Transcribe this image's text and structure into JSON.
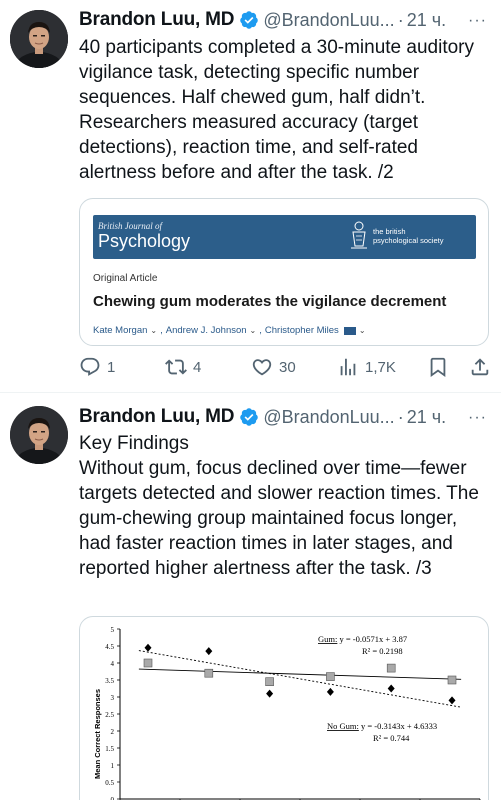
{
  "tweets": [
    {
      "author": {
        "name": "Brandon Luu, MD",
        "handle": "@BrandonLuu...",
        "dot": "·",
        "time": "21 ч."
      },
      "more": "···",
      "text": "40 participants completed a 30-minute auditory vigilance task, detecting specific number sequences. Half chewed gum, half didn’t. Researchers measured accuracy (target detections), reaction time, and self-rated alertness before and after the task. /2",
      "card": {
        "journal_small": "British Journal of",
        "journal_big": "Psychology",
        "society": "the british\npsychological society",
        "article_type": "Original Article",
        "title": "Chewing gum moderates the vigilance decrement",
        "authors": [
          "Kate Morgan",
          "Andrew J. Johnson",
          "Christopher Miles"
        ]
      },
      "actions": {
        "replies": "1",
        "retweets": "4",
        "likes": "30",
        "views": "1,7K"
      }
    },
    {
      "author": {
        "name": "Brandon Luu, MD",
        "handle": "@BrandonLuu...",
        "dot": "·",
        "time": "21 ч."
      },
      "more": "···",
      "text": "Key Findings\nWithout gum, focus declined over time—fewer targets detected and slower reaction times. The gum-chewing group maintained focus longer, had faster reaction times in later stages, and reported higher alertness after the task. /3"
    }
  ],
  "chart_data": {
    "type": "scatter",
    "ylabel": "Mean Correct Responses",
    "ylim": [
      0,
      5
    ],
    "yticks": [
      "0",
      "0.5",
      "1",
      "1.5",
      "2",
      "2.5",
      "3",
      "3.5",
      "4",
      "4.5",
      "5"
    ],
    "x": [
      1,
      2,
      3,
      4,
      5,
      6
    ],
    "series": [
      {
        "name": "Gum",
        "marker": "square",
        "values": [
          4.0,
          3.7,
          3.45,
          3.6,
          3.85,
          3.5
        ],
        "fit_label": "Gum:",
        "equation": "y = -0.0571x + 3.87",
        "r2": "R² = 0.2198",
        "fit": {
          "slope": -0.0571,
          "intercept": 3.87
        }
      },
      {
        "name": "No Gum",
        "marker": "diamond",
        "values": [
          4.45,
          4.35,
          3.1,
          3.15,
          3.25,
          2.9
        ],
        "fit_label": "No Gum:",
        "equation": "y = -0.3143x + 4.6333",
        "r2": "R² = 0.744",
        "fit": {
          "slope": -0.3143,
          "intercept": 4.6333
        }
      }
    ],
    "colors": {
      "gum_marker": "#a9a9a9",
      "nogum_marker": "#000000",
      "line": "#000000"
    }
  },
  "colors": {
    "verified": "#1d9bf0",
    "journal": "#2c5e8a",
    "muted": "#536471"
  }
}
